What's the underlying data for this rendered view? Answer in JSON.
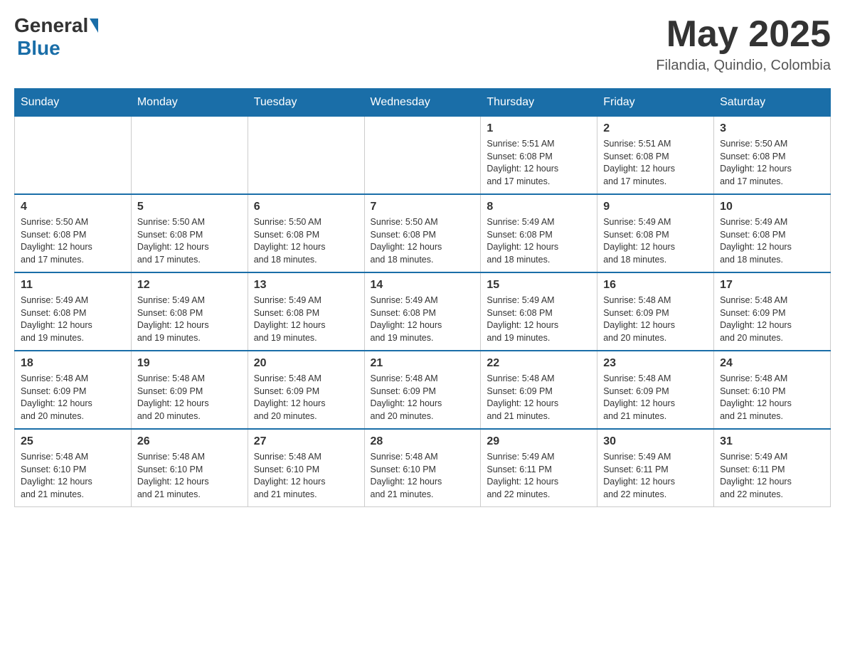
{
  "header": {
    "logo_general": "General",
    "logo_blue": "Blue",
    "month_year": "May 2025",
    "location": "Filandia, Quindio, Colombia"
  },
  "weekdays": [
    "Sunday",
    "Monday",
    "Tuesday",
    "Wednesday",
    "Thursday",
    "Friday",
    "Saturday"
  ],
  "weeks": [
    [
      {
        "day": "",
        "info": ""
      },
      {
        "day": "",
        "info": ""
      },
      {
        "day": "",
        "info": ""
      },
      {
        "day": "",
        "info": ""
      },
      {
        "day": "1",
        "info": "Sunrise: 5:51 AM\nSunset: 6:08 PM\nDaylight: 12 hours\nand 17 minutes."
      },
      {
        "day": "2",
        "info": "Sunrise: 5:51 AM\nSunset: 6:08 PM\nDaylight: 12 hours\nand 17 minutes."
      },
      {
        "day": "3",
        "info": "Sunrise: 5:50 AM\nSunset: 6:08 PM\nDaylight: 12 hours\nand 17 minutes."
      }
    ],
    [
      {
        "day": "4",
        "info": "Sunrise: 5:50 AM\nSunset: 6:08 PM\nDaylight: 12 hours\nand 17 minutes."
      },
      {
        "day": "5",
        "info": "Sunrise: 5:50 AM\nSunset: 6:08 PM\nDaylight: 12 hours\nand 17 minutes."
      },
      {
        "day": "6",
        "info": "Sunrise: 5:50 AM\nSunset: 6:08 PM\nDaylight: 12 hours\nand 18 minutes."
      },
      {
        "day": "7",
        "info": "Sunrise: 5:50 AM\nSunset: 6:08 PM\nDaylight: 12 hours\nand 18 minutes."
      },
      {
        "day": "8",
        "info": "Sunrise: 5:49 AM\nSunset: 6:08 PM\nDaylight: 12 hours\nand 18 minutes."
      },
      {
        "day": "9",
        "info": "Sunrise: 5:49 AM\nSunset: 6:08 PM\nDaylight: 12 hours\nand 18 minutes."
      },
      {
        "day": "10",
        "info": "Sunrise: 5:49 AM\nSunset: 6:08 PM\nDaylight: 12 hours\nand 18 minutes."
      }
    ],
    [
      {
        "day": "11",
        "info": "Sunrise: 5:49 AM\nSunset: 6:08 PM\nDaylight: 12 hours\nand 19 minutes."
      },
      {
        "day": "12",
        "info": "Sunrise: 5:49 AM\nSunset: 6:08 PM\nDaylight: 12 hours\nand 19 minutes."
      },
      {
        "day": "13",
        "info": "Sunrise: 5:49 AM\nSunset: 6:08 PM\nDaylight: 12 hours\nand 19 minutes."
      },
      {
        "day": "14",
        "info": "Sunrise: 5:49 AM\nSunset: 6:08 PM\nDaylight: 12 hours\nand 19 minutes."
      },
      {
        "day": "15",
        "info": "Sunrise: 5:49 AM\nSunset: 6:08 PM\nDaylight: 12 hours\nand 19 minutes."
      },
      {
        "day": "16",
        "info": "Sunrise: 5:48 AM\nSunset: 6:09 PM\nDaylight: 12 hours\nand 20 minutes."
      },
      {
        "day": "17",
        "info": "Sunrise: 5:48 AM\nSunset: 6:09 PM\nDaylight: 12 hours\nand 20 minutes."
      }
    ],
    [
      {
        "day": "18",
        "info": "Sunrise: 5:48 AM\nSunset: 6:09 PM\nDaylight: 12 hours\nand 20 minutes."
      },
      {
        "day": "19",
        "info": "Sunrise: 5:48 AM\nSunset: 6:09 PM\nDaylight: 12 hours\nand 20 minutes."
      },
      {
        "day": "20",
        "info": "Sunrise: 5:48 AM\nSunset: 6:09 PM\nDaylight: 12 hours\nand 20 minutes."
      },
      {
        "day": "21",
        "info": "Sunrise: 5:48 AM\nSunset: 6:09 PM\nDaylight: 12 hours\nand 20 minutes."
      },
      {
        "day": "22",
        "info": "Sunrise: 5:48 AM\nSunset: 6:09 PM\nDaylight: 12 hours\nand 21 minutes."
      },
      {
        "day": "23",
        "info": "Sunrise: 5:48 AM\nSunset: 6:09 PM\nDaylight: 12 hours\nand 21 minutes."
      },
      {
        "day": "24",
        "info": "Sunrise: 5:48 AM\nSunset: 6:10 PM\nDaylight: 12 hours\nand 21 minutes."
      }
    ],
    [
      {
        "day": "25",
        "info": "Sunrise: 5:48 AM\nSunset: 6:10 PM\nDaylight: 12 hours\nand 21 minutes."
      },
      {
        "day": "26",
        "info": "Sunrise: 5:48 AM\nSunset: 6:10 PM\nDaylight: 12 hours\nand 21 minutes."
      },
      {
        "day": "27",
        "info": "Sunrise: 5:48 AM\nSunset: 6:10 PM\nDaylight: 12 hours\nand 21 minutes."
      },
      {
        "day": "28",
        "info": "Sunrise: 5:48 AM\nSunset: 6:10 PM\nDaylight: 12 hours\nand 21 minutes."
      },
      {
        "day": "29",
        "info": "Sunrise: 5:49 AM\nSunset: 6:11 PM\nDaylight: 12 hours\nand 22 minutes."
      },
      {
        "day": "30",
        "info": "Sunrise: 5:49 AM\nSunset: 6:11 PM\nDaylight: 12 hours\nand 22 minutes."
      },
      {
        "day": "31",
        "info": "Sunrise: 5:49 AM\nSunset: 6:11 PM\nDaylight: 12 hours\nand 22 minutes."
      }
    ]
  ]
}
